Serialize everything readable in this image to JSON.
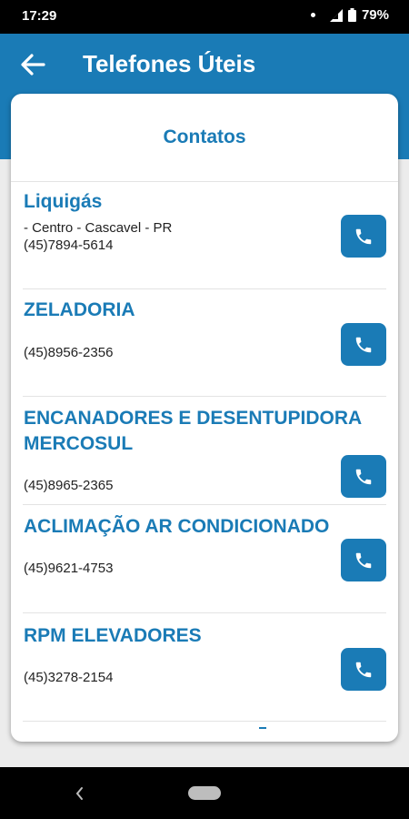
{
  "status": {
    "time": "17:29",
    "battery": "79%"
  },
  "app_bar": {
    "title": "Telefones Úteis"
  },
  "card": {
    "title": "Contatos"
  },
  "contacts": [
    {
      "name": "Liquigás",
      "address": " - Centro - Cascavel - PR",
      "phone": "(45)7894-5614"
    },
    {
      "name": "ZELADORIA",
      "phone": "(45)8956-2356"
    },
    {
      "name": "ENCANADORES E DESENTUPIDORA MERCOSUL",
      "phone": "(45)8965-2365"
    },
    {
      "name": "ACLIMAÇÃO AR CONDICIONADO",
      "phone": "(45)9621-4753"
    },
    {
      "name": "RPM ELEVADORES",
      "phone": "(45)3278-2154"
    }
  ],
  "colors": {
    "primary": "#1a7bb6",
    "background": "#ececec"
  },
  "icons": {
    "back": "arrow-left-icon",
    "call": "phone-icon"
  }
}
